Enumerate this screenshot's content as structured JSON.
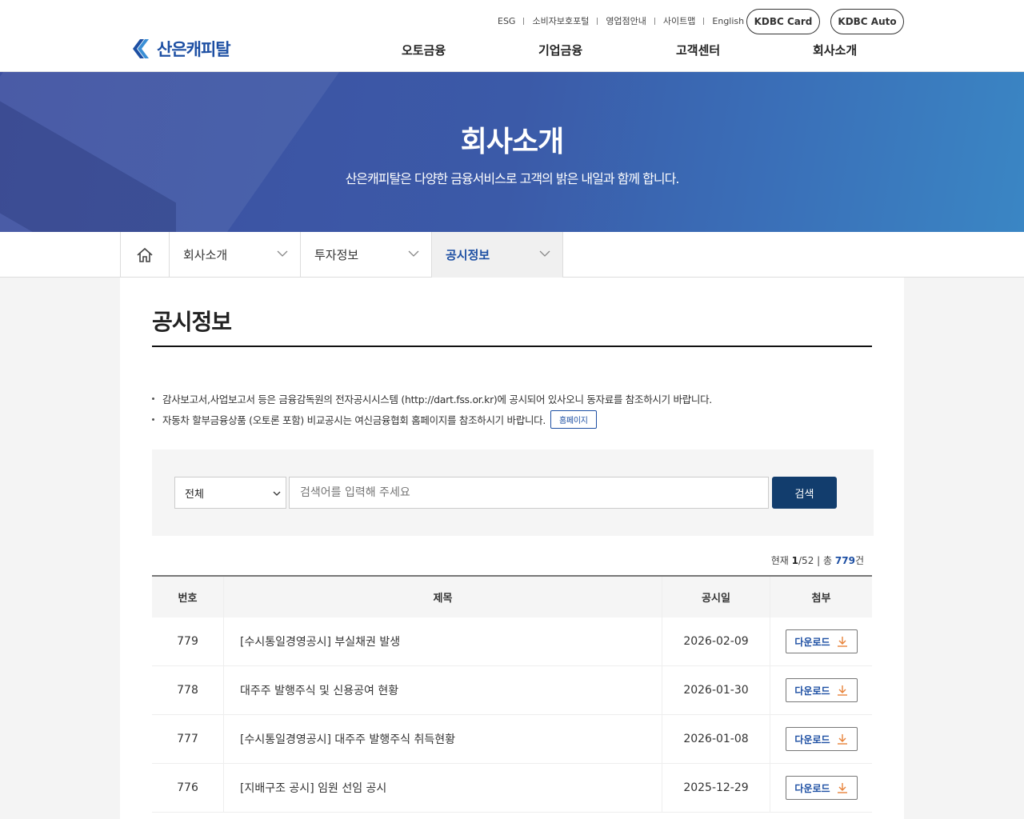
{
  "header": {
    "logo_text": "산은캐피탈",
    "util_links": [
      "ESG",
      "소비자보호포털",
      "영업점안내",
      "사이트맵",
      "English"
    ],
    "pill_buttons": [
      "KDBC Card",
      "KDBC Auto"
    ],
    "gnb": [
      "오토금융",
      "기업금융",
      "고객센터",
      "회사소개"
    ]
  },
  "banner": {
    "title": "회사소개",
    "subtitle": "산은캐피탈은 다양한 금융서비스로 고객의 밝은 내일과 함께 합니다."
  },
  "lnb": {
    "items": [
      {
        "label": "회사소개"
      },
      {
        "label": "투자정보"
      },
      {
        "label": "공시정보"
      }
    ]
  },
  "main": {
    "title": "공시정보",
    "notices": [
      "감사보고서,사업보고서 등은 금융감독원의 전자공시시스템 (http://dart.fss.or.kr)에 공시되어 있사오니 동자료를 참조하시기 바랍니다.",
      "자동차 할부금융상품 (오토론 포함) 비교공시는 여신금융협회 홈페이지를 참조하시기 바랍니다."
    ],
    "homepage_button": "홈페이지",
    "search": {
      "select_value": "전체",
      "placeholder": "검색어를 입력해 주세요",
      "button": "검색"
    },
    "count": {
      "prefix": "현재",
      "current_page": "1",
      "total_pages": "/52",
      "total_label": "| 총",
      "total": "779",
      "suffix": "건"
    },
    "table": {
      "headers": [
        "번호",
        "제목",
        "공시일",
        "첨부"
      ],
      "rows": [
        {
          "no": "779",
          "title": "[수시통일경영공시] 부실채권 발생",
          "date": "2026-02-09",
          "attach": "다운로드"
        },
        {
          "no": "778",
          "title": "대주주 발행주식 및 신용공여 현황",
          "date": "2026-01-30",
          "attach": "다운로드"
        },
        {
          "no": "777",
          "title": "[수시통일경영공시] 대주주 발행주식 취득현황",
          "date": "2026-01-08",
          "attach": "다운로드"
        },
        {
          "no": "776",
          "title": "[지배구조 공시] 임원 선임 공시",
          "date": "2025-12-29",
          "attach": "다운로드"
        }
      ]
    }
  },
  "colors": {
    "brand": "#1d4fa3",
    "search_button": "#123d6d",
    "download_arrow": "#e8833a"
  }
}
